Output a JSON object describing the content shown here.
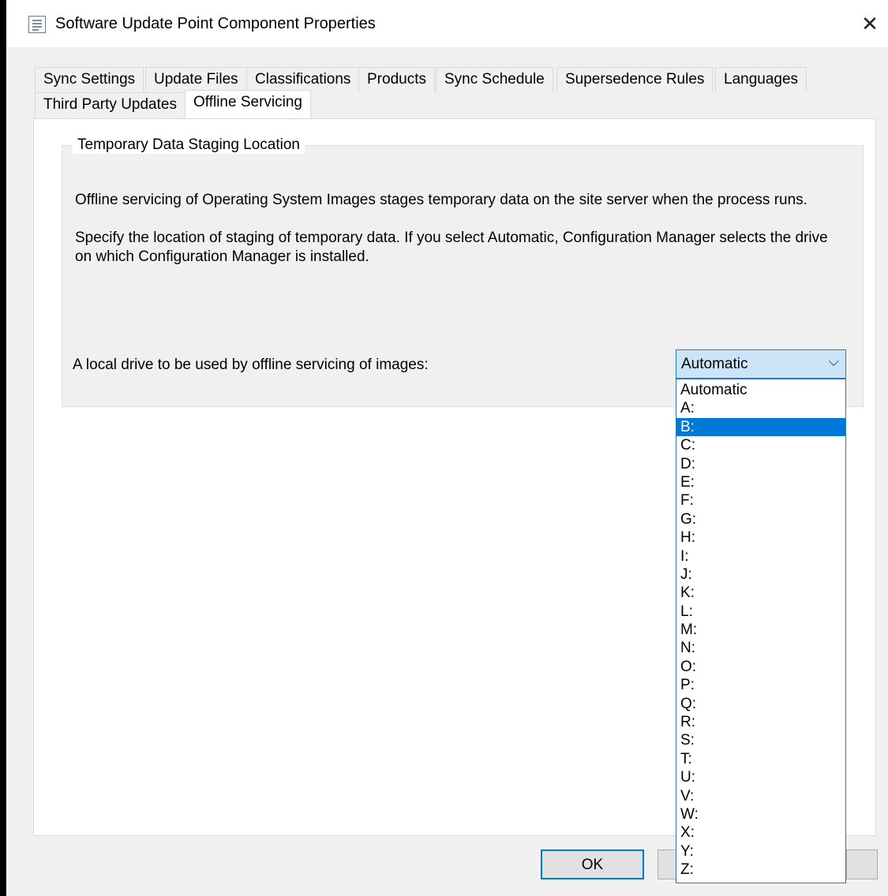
{
  "window": {
    "title": "Software Update Point Component Properties",
    "close_symbol": "✕"
  },
  "tabs": [
    {
      "label": "Sync Settings",
      "active": false
    },
    {
      "label": "Update Files",
      "active": false
    },
    {
      "label": "Classifications",
      "active": false
    },
    {
      "label": "Products",
      "active": false
    },
    {
      "label": "Sync Schedule",
      "active": false
    },
    {
      "label": "Supersedence Rules",
      "active": false
    },
    {
      "label": "Languages",
      "active": false
    },
    {
      "label": "Third Party Updates",
      "active": false
    },
    {
      "label": "Offline Servicing",
      "active": true
    }
  ],
  "group": {
    "title": "Temporary Data Staging Location",
    "text1": "Offline servicing of Operating System Images stages temporary data on the site server when the process runs.",
    "text2_line1": "Specify the location of staging of temporary data. If you select Automatic, Configuration Manager selects the drive",
    "text2_line2": "on which Configuration Manager is installed.",
    "drive_label": "A local drive to be used by offline servicing of images:"
  },
  "drive_select": {
    "value": "Automatic",
    "chevron": "⌵",
    "highlighted": "B:",
    "options": [
      "Automatic",
      "A:",
      "B:",
      "C:",
      "D:",
      "E:",
      "F:",
      "G:",
      "H:",
      "I:",
      "J:",
      "K:",
      "L:",
      "M:",
      "N:",
      "O:",
      "P:",
      "Q:",
      "R:",
      "S:",
      "T:",
      "U:",
      "V:",
      "W:",
      "X:",
      "Y:",
      "Z:"
    ]
  },
  "buttons": {
    "ok": "OK",
    "cancel": "",
    "apply": ""
  },
  "colors": {
    "accent": "#0078d7",
    "combo_focus": "#cce4f7"
  }
}
